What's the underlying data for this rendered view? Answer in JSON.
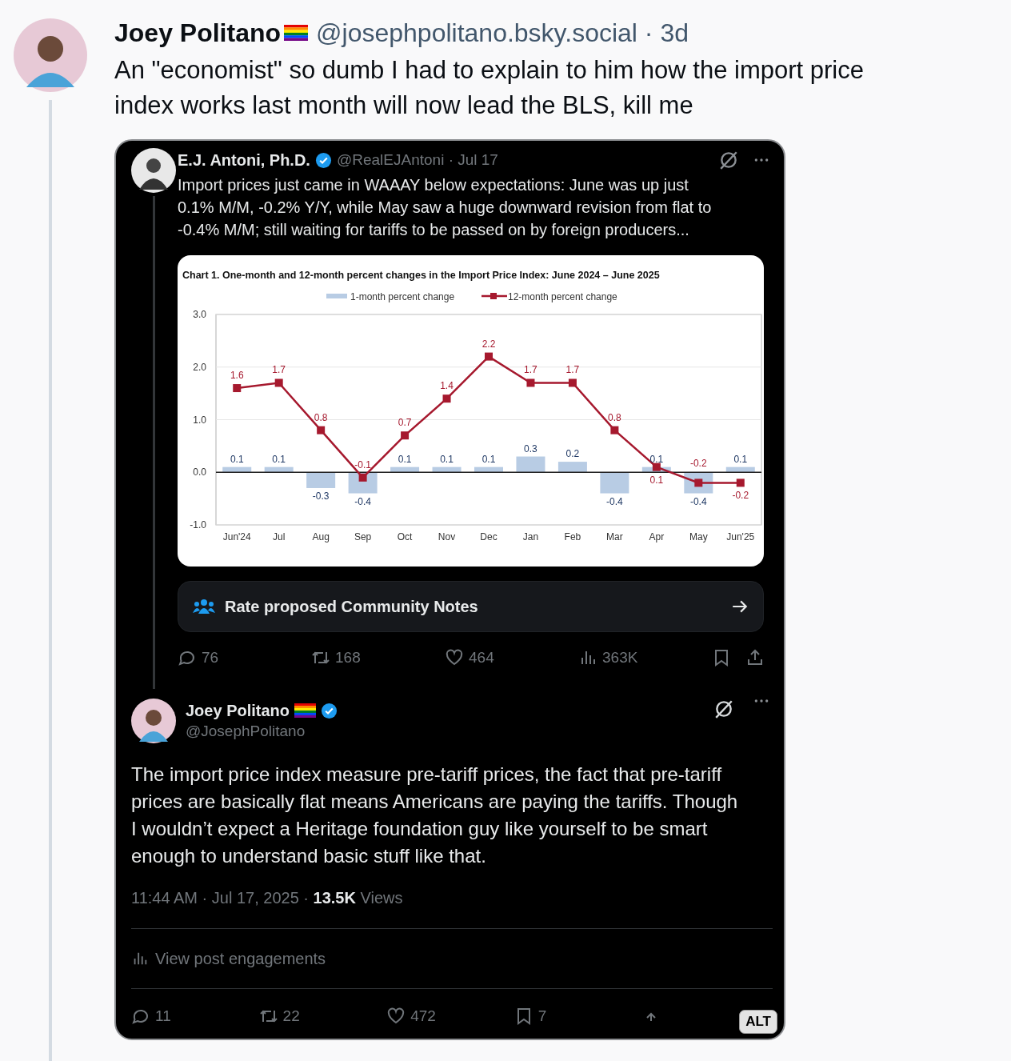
{
  "post": {
    "author": "Joey Politano",
    "meta": "@josephpolitano.bsky.social · 3d",
    "text": "An \"economist\" so dumb I had to explain to him how the import price index works last month will now lead the BLS, kill me"
  },
  "embed": {
    "alt_badge": "ALT",
    "quoted_tweet": {
      "author": "E.J. Antoni, Ph.D.",
      "meta": "@RealEJAntoni · Jul 17",
      "text": "Import prices just came in WAAAY below expectations: June was up just 0.1% M/M, -0.2% Y/Y, while May saw a huge downward revision from flat to -0.4% M/M; still waiting for tariffs to be passed on by foreign producers...",
      "chart_data": {
        "type": "bar",
        "title": "Chart 1. One-month and 12-month percent changes in the Import Price Index: June 2024 – June 2025",
        "categories": [
          "Jun'24",
          "Jul",
          "Aug",
          "Sep",
          "Oct",
          "Nov",
          "Dec",
          "Jan",
          "Feb",
          "Mar",
          "Apr",
          "May",
          "Jun'25"
        ],
        "series": [
          {
            "name": "1-month percent change",
            "type": "bar",
            "color": "#b8cce4",
            "values": [
              0.1,
              0.1,
              -0.3,
              -0.4,
              0.1,
              0.1,
              0.1,
              0.3,
              0.2,
              -0.4,
              0.1,
              -0.4,
              0.1
            ]
          },
          {
            "name": "12-month percent change",
            "type": "line",
            "marker": "square",
            "color": "#a6192e",
            "values": [
              1.6,
              1.7,
              0.8,
              -0.1,
              0.7,
              1.4,
              2.2,
              1.7,
              1.7,
              0.8,
              0.1,
              -0.2,
              -0.2
            ]
          }
        ],
        "legend": "top",
        "ylim": [
          -1,
          3
        ],
        "yticks": [
          {
            "value": -1,
            "label": "-1.0"
          },
          {
            "value": 0,
            "label": "0.0"
          },
          {
            "value": 1,
            "label": "1.0"
          },
          {
            "value": 2,
            "label": "2.0"
          },
          {
            "value": 3,
            "label": "3.0"
          }
        ],
        "data_labels": true
      },
      "community_notes": "Rate proposed Community Notes",
      "actions": [
        {
          "kind": "reply",
          "count": "76"
        },
        {
          "kind": "repost",
          "count": "168"
        },
        {
          "kind": "like",
          "count": "464"
        },
        {
          "kind": "views",
          "count": "363K"
        },
        {
          "kind": "bookmark"
        },
        {
          "kind": "share"
        }
      ]
    },
    "reply_tweet": {
      "author": "Joey Politano",
      "handle": "@JosephPolitano",
      "text": "The import price index measure pre-tariff prices, the fact that pre-tariff prices are basically flat means Americans are paying the tariffs. Though I wouldn’t expect a Heritage foundation guy like yourself to be smart enough to understand basic stuff like that.",
      "timestamp": "11:44 AM · Jul 17, 2025 · **13.5K** Views",
      "engagements": "View post engagements",
      "actions": [
        {
          "kind": "reply",
          "count": "11"
        },
        {
          "kind": "repost",
          "count": "22"
        },
        {
          "kind": "like",
          "count": "472"
        },
        {
          "kind": "bookmark",
          "count": "7"
        },
        {
          "kind": "share"
        }
      ]
    }
  }
}
